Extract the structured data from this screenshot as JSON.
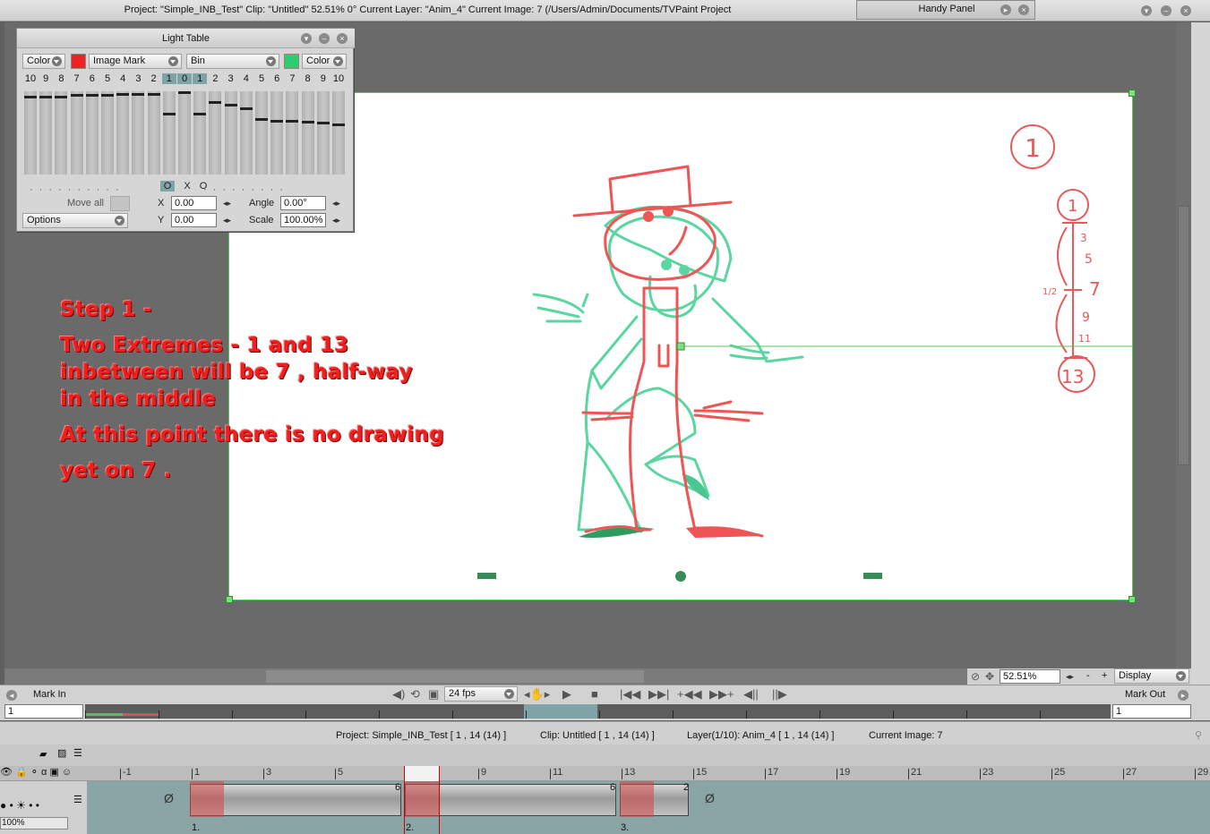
{
  "window": {
    "title": "Project:  \"Simple_INB_Test\"  Clip: \"Untitled\"   52.51%   0°  Current Layer: \"Anim_4\"  Current Image: 7 (/Users/Admin/Documents/TVPaint Project",
    "handy_panel": "Handy Panel"
  },
  "light_table": {
    "title": "Light Table",
    "left_mode": "Color",
    "left_color": "#ee2222",
    "image_mark": "Image Mark",
    "bin": "Bin",
    "right_color": "#2ecc71",
    "right_mode": "Color",
    "before_numbers": [
      "10",
      "9",
      "8",
      "7",
      "6",
      "5",
      "4",
      "3",
      "2",
      "1"
    ],
    "center_number": "0",
    "after_numbers": [
      "1",
      "2",
      "3",
      "4",
      "5",
      "6",
      "7",
      "8",
      "9",
      "10"
    ],
    "before_levels": [
      0.95,
      0.95,
      0.95,
      0.97,
      0.97,
      0.97,
      0.98,
      0.98,
      0.98,
      0.73
    ],
    "center_level": 1.0,
    "after_levels": [
      0.73,
      0.88,
      0.85,
      0.8,
      0.67,
      0.65,
      0.64,
      0.63,
      0.62,
      0.6
    ],
    "toggles": [
      "O",
      "X",
      "O"
    ],
    "move_all": "Move all",
    "options": "Options",
    "x_label": "X",
    "x_value": "0.00",
    "y_label": "Y",
    "y_value": "0.00",
    "angle_label": "Angle",
    "angle_value": "0.00°",
    "scale_label": "Scale",
    "scale_value": "100.00%"
  },
  "annotation": {
    "line1": "Step 1 -",
    "line2": "Two Extremes -  1 and 13",
    "line3": "inbetween will be  7 , half-way",
    "line4": "in the middle",
    "line5": "At this point there is no drawing",
    "line6": "yet on 7 ."
  },
  "timing_chart": [
    "1",
    "3",
    "5",
    "7",
    "9",
    "11",
    "13",
    "1/2"
  ],
  "canvas_marks": [
    "1"
  ],
  "view": {
    "zoom": "52.51%",
    "display": "Display"
  },
  "transport": {
    "mark_in": "Mark In",
    "mark_out": "Mark Out",
    "fps": "24 fps",
    "mark_in_value": "1",
    "mark_out_value": "1"
  },
  "timeline_info": {
    "project": "Project: Simple_INB_Test [ 1 , 14  (14) ]",
    "clip": "Clip: Untitled [ 1 , 14  (14) ]",
    "layer": "Layer(1/10): Anim_4 [ 1 , 14  (14) ]",
    "current_image": "Current Image: 7"
  },
  "timeline": {
    "ruler": [
      "-1",
      "1",
      "3",
      "5",
      "7",
      "9",
      "11",
      "13",
      "15",
      "17",
      "19",
      "21",
      "23",
      "25",
      "27",
      "29"
    ],
    "opacity": "100%",
    "cels": [
      {
        "label": "1.",
        "duration": "6"
      },
      {
        "label": "2.",
        "duration": "6"
      },
      {
        "label": "3.",
        "duration": "2"
      }
    ],
    "empty_symbol": "Ø"
  }
}
